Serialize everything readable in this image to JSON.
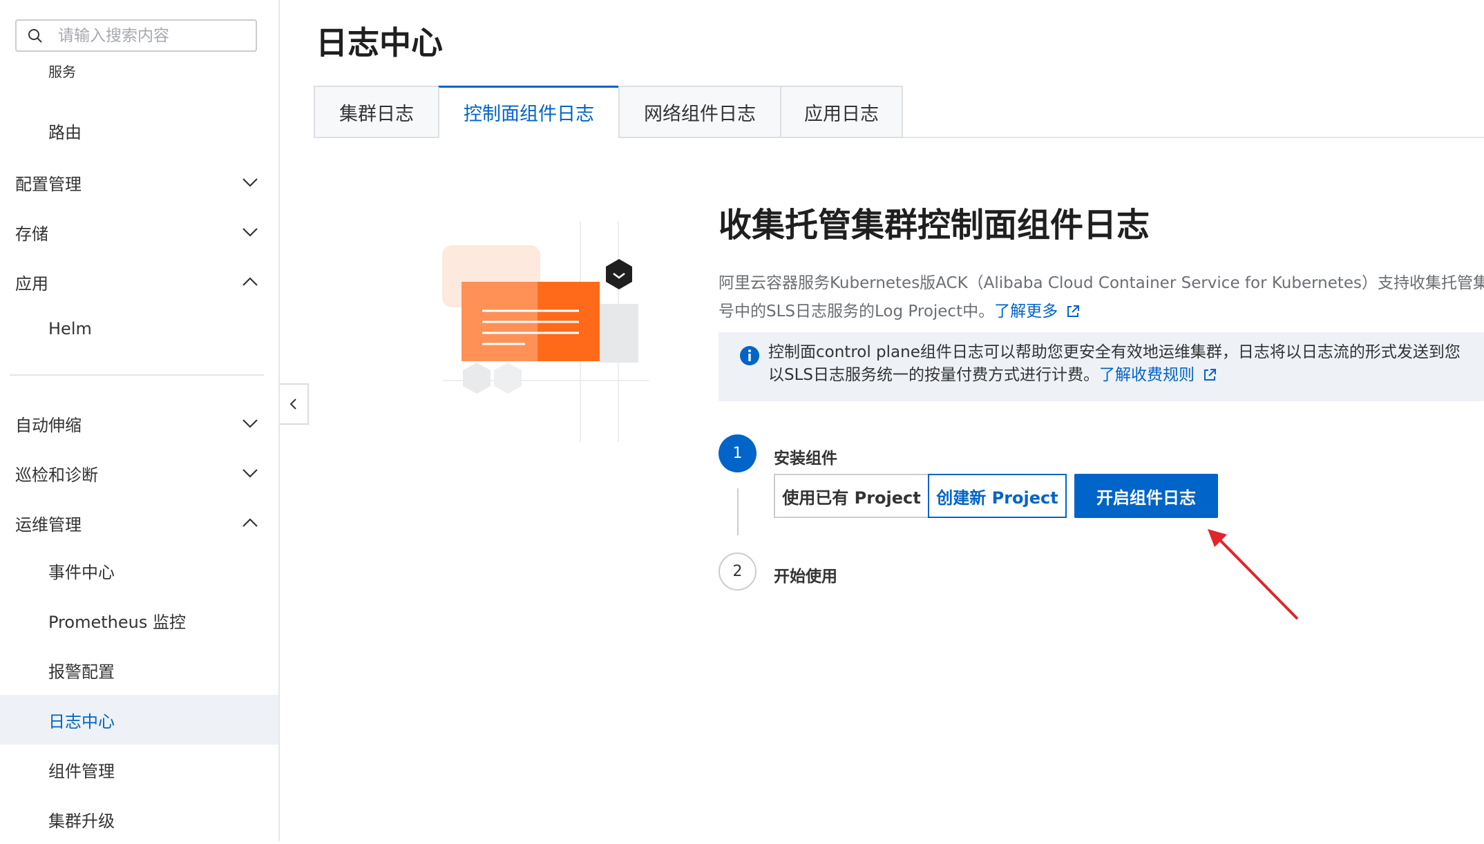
{
  "sidebar": {
    "search_placeholder": "请输入搜索内容",
    "items": [
      {
        "label": "服务"
      },
      {
        "label": "路由"
      },
      {
        "label": "配置管理"
      },
      {
        "label": "存储"
      },
      {
        "label": "应用"
      },
      {
        "label": "Helm"
      },
      {
        "label": "自动伸缩"
      },
      {
        "label": "巡检和诊断"
      },
      {
        "label": "运维管理"
      },
      {
        "label": "事件中心"
      },
      {
        "label": "Prometheus 监控"
      },
      {
        "label": "报警配置"
      },
      {
        "label": "日志中心"
      },
      {
        "label": "组件管理"
      },
      {
        "label": "集群升级"
      }
    ]
  },
  "page": {
    "title": "日志中心",
    "tabs": [
      {
        "label": "集群日志"
      },
      {
        "label": "控制面组件日志"
      },
      {
        "label": "网络组件日志"
      },
      {
        "label": "应用日志"
      }
    ]
  },
  "content": {
    "title": "收集托管集群控制面组件日志",
    "desc_line1": "阿里云容器服务Kubernetes版ACK（Alibaba Cloud Container Service for Kubernetes）支持收集托管集",
    "desc_line2": "号中的SLS日志服务的Log Project中。",
    "learn_more": "了解更多",
    "info_line1": "控制面control plane组件日志可以帮助您更安全有效地运维集群，日志将以日志流的形式发送到您",
    "info_line2": "以SLS日志服务统一的按量付费方式进行计费。",
    "billing_link": "了解收费规则",
    "steps": [
      {
        "number": "1",
        "label": "安装组件"
      },
      {
        "number": "2",
        "label": "开始使用"
      }
    ],
    "project_options": [
      "使用已有 Project",
      "创建新 Project"
    ],
    "enable_button": "开启组件日志"
  },
  "colors": {
    "accent": "#0064c8",
    "annotation_arrow": "#e0262b",
    "illustration_orange": "#ff6a1a"
  }
}
